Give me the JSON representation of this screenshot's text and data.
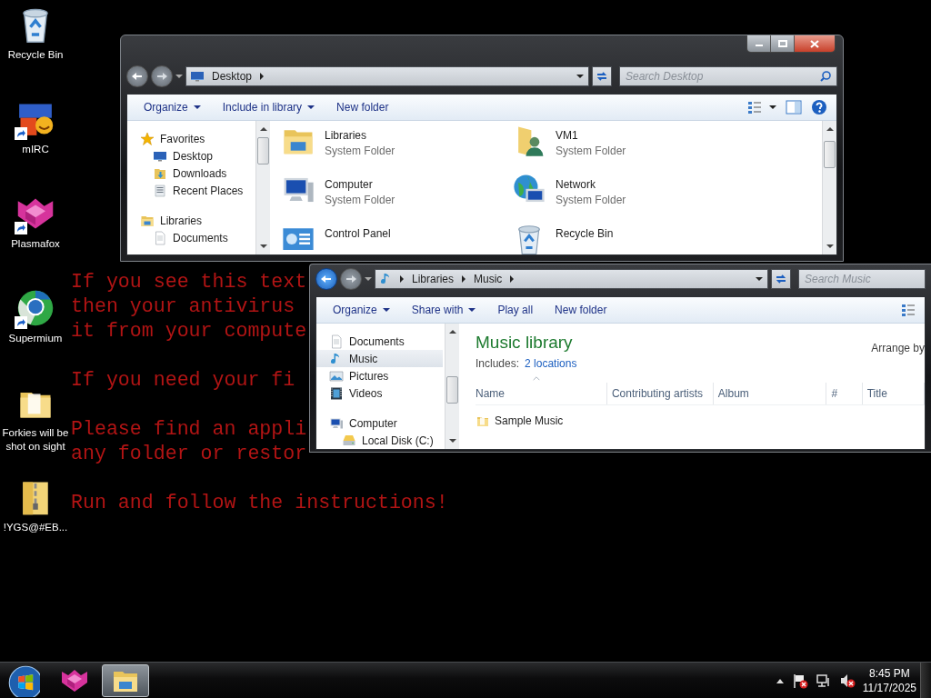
{
  "desktop_icons": [
    {
      "label": "Recycle Bin",
      "kind": "recycle",
      "shortcut": false
    },
    {
      "label": "mIRC",
      "kind": "mirc",
      "shortcut": true
    },
    {
      "label": "Plasmafox",
      "kind": "plasmafox",
      "shortcut": true
    },
    {
      "label": "Supermium",
      "kind": "supermium",
      "shortcut": true
    },
    {
      "label": "Forkies will be shot on sight",
      "kind": "folder",
      "shortcut": false
    },
    {
      "label": "!YGS@#EB...",
      "kind": "zip",
      "shortcut": false
    }
  ],
  "ransom_note": {
    "paragraphs": [
      [
        "If you see this text",
        "then your antivirus",
        "it from your compute"
      ],
      [
        "If you need your fi"
      ],
      [
        "Please find an appli",
        "any folder or restor"
      ],
      [
        "Run and follow the instructions!"
      ]
    ]
  },
  "windows": [
    {
      "kind": "desktop",
      "window_controls": true,
      "address": [
        "Desktop"
      ],
      "search_placeholder": "Search Desktop",
      "toolbar": [
        {
          "label": "Organize",
          "dropdown": true
        },
        {
          "label": "Include in library",
          "dropdown": true
        },
        {
          "label": "New folder",
          "dropdown": false
        }
      ],
      "nav": [
        {
          "label": "Favorites",
          "kind": "star",
          "selected": false,
          "children": [
            {
              "label": "Desktop",
              "kind": "desktop",
              "selected": false
            },
            {
              "label": "Downloads",
              "kind": "downloads",
              "selected": false
            },
            {
              "label": "Recent Places",
              "kind": "recent",
              "selected": false
            }
          ]
        },
        {
          "label": "Libraries",
          "kind": "library",
          "selected": false,
          "children": [
            {
              "label": "Documents",
              "kind": "document",
              "selected": false
            }
          ]
        }
      ],
      "items": [
        {
          "name": "Libraries",
          "subtitle": "System Folder",
          "kind": "library"
        },
        {
          "name": "VM1",
          "subtitle": "System Folder",
          "kind": "user"
        },
        {
          "name": "Computer",
          "subtitle": "System Folder",
          "kind": "computer"
        },
        {
          "name": "Network",
          "subtitle": "System Folder",
          "kind": "network"
        },
        {
          "name": "Control Panel",
          "kind": "control"
        },
        {
          "name": "Recycle Bin",
          "kind": "recycle"
        }
      ]
    },
    {
      "kind": "music_library",
      "window_controls": false,
      "address": [
        "Libraries",
        "Music"
      ],
      "search_placeholder": "Search Music",
      "toolbar": [
        {
          "label": "Organize",
          "dropdown": true
        },
        {
          "label": "Share with",
          "dropdown": true
        },
        {
          "label": "Play all",
          "dropdown": false
        },
        {
          "label": "New folder",
          "dropdown": false
        }
      ],
      "nav": [
        {
          "label": "Documents",
          "kind": "document",
          "selected": false
        },
        {
          "label": "Music",
          "kind": "music",
          "selected": true
        },
        {
          "label": "Pictures",
          "kind": "picture",
          "selected": false
        },
        {
          "label": "Videos",
          "kind": "video",
          "selected": false
        },
        {
          "label": "Computer",
          "kind": "computer",
          "selected": false,
          "children": [
            {
              "label": "Local Disk (C:)",
              "kind": "drive",
              "selected": false
            }
          ]
        }
      ],
      "library": {
        "title": "Music library",
        "includes_label": "Includes:",
        "locations_link": "2 locations",
        "arrange_label": "Arrange by"
      },
      "columns": [
        "Name",
        "Contributing artists",
        "Album",
        "#",
        "Title"
      ],
      "rows": [
        {
          "name": "Sample Music",
          "kind": "folder"
        }
      ]
    }
  ],
  "taskbar": {
    "buttons": [
      {
        "kind": "plasmafox",
        "selected": false
      },
      {
        "kind": "explorer",
        "selected": true
      }
    ],
    "time": "8:45 PM",
    "date": "11/17/2025"
  }
}
